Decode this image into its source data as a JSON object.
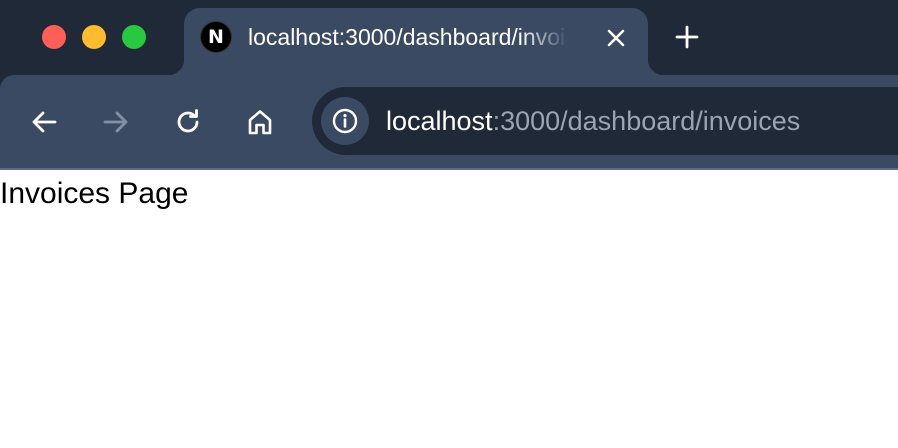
{
  "browser": {
    "tab": {
      "favicon_letter": "N",
      "title": "localhost:3000/dashboard/invoices"
    },
    "address_bar": {
      "host": "localhost",
      "path": ":3000/dashboard/invoices"
    },
    "icons": {
      "back": "arrow-left-icon",
      "forward": "arrow-right-icon",
      "reload": "reload-icon",
      "home": "home-icon",
      "info": "info-icon",
      "close": "close-icon",
      "new_tab": "plus-icon"
    },
    "colors": {
      "frame": "#1f2937",
      "tab_active": "#3a4a63",
      "traffic_red": "#ff5f57",
      "traffic_yellow": "#febc2e",
      "traffic_green": "#28c840"
    }
  },
  "page": {
    "heading": "Invoices Page"
  }
}
